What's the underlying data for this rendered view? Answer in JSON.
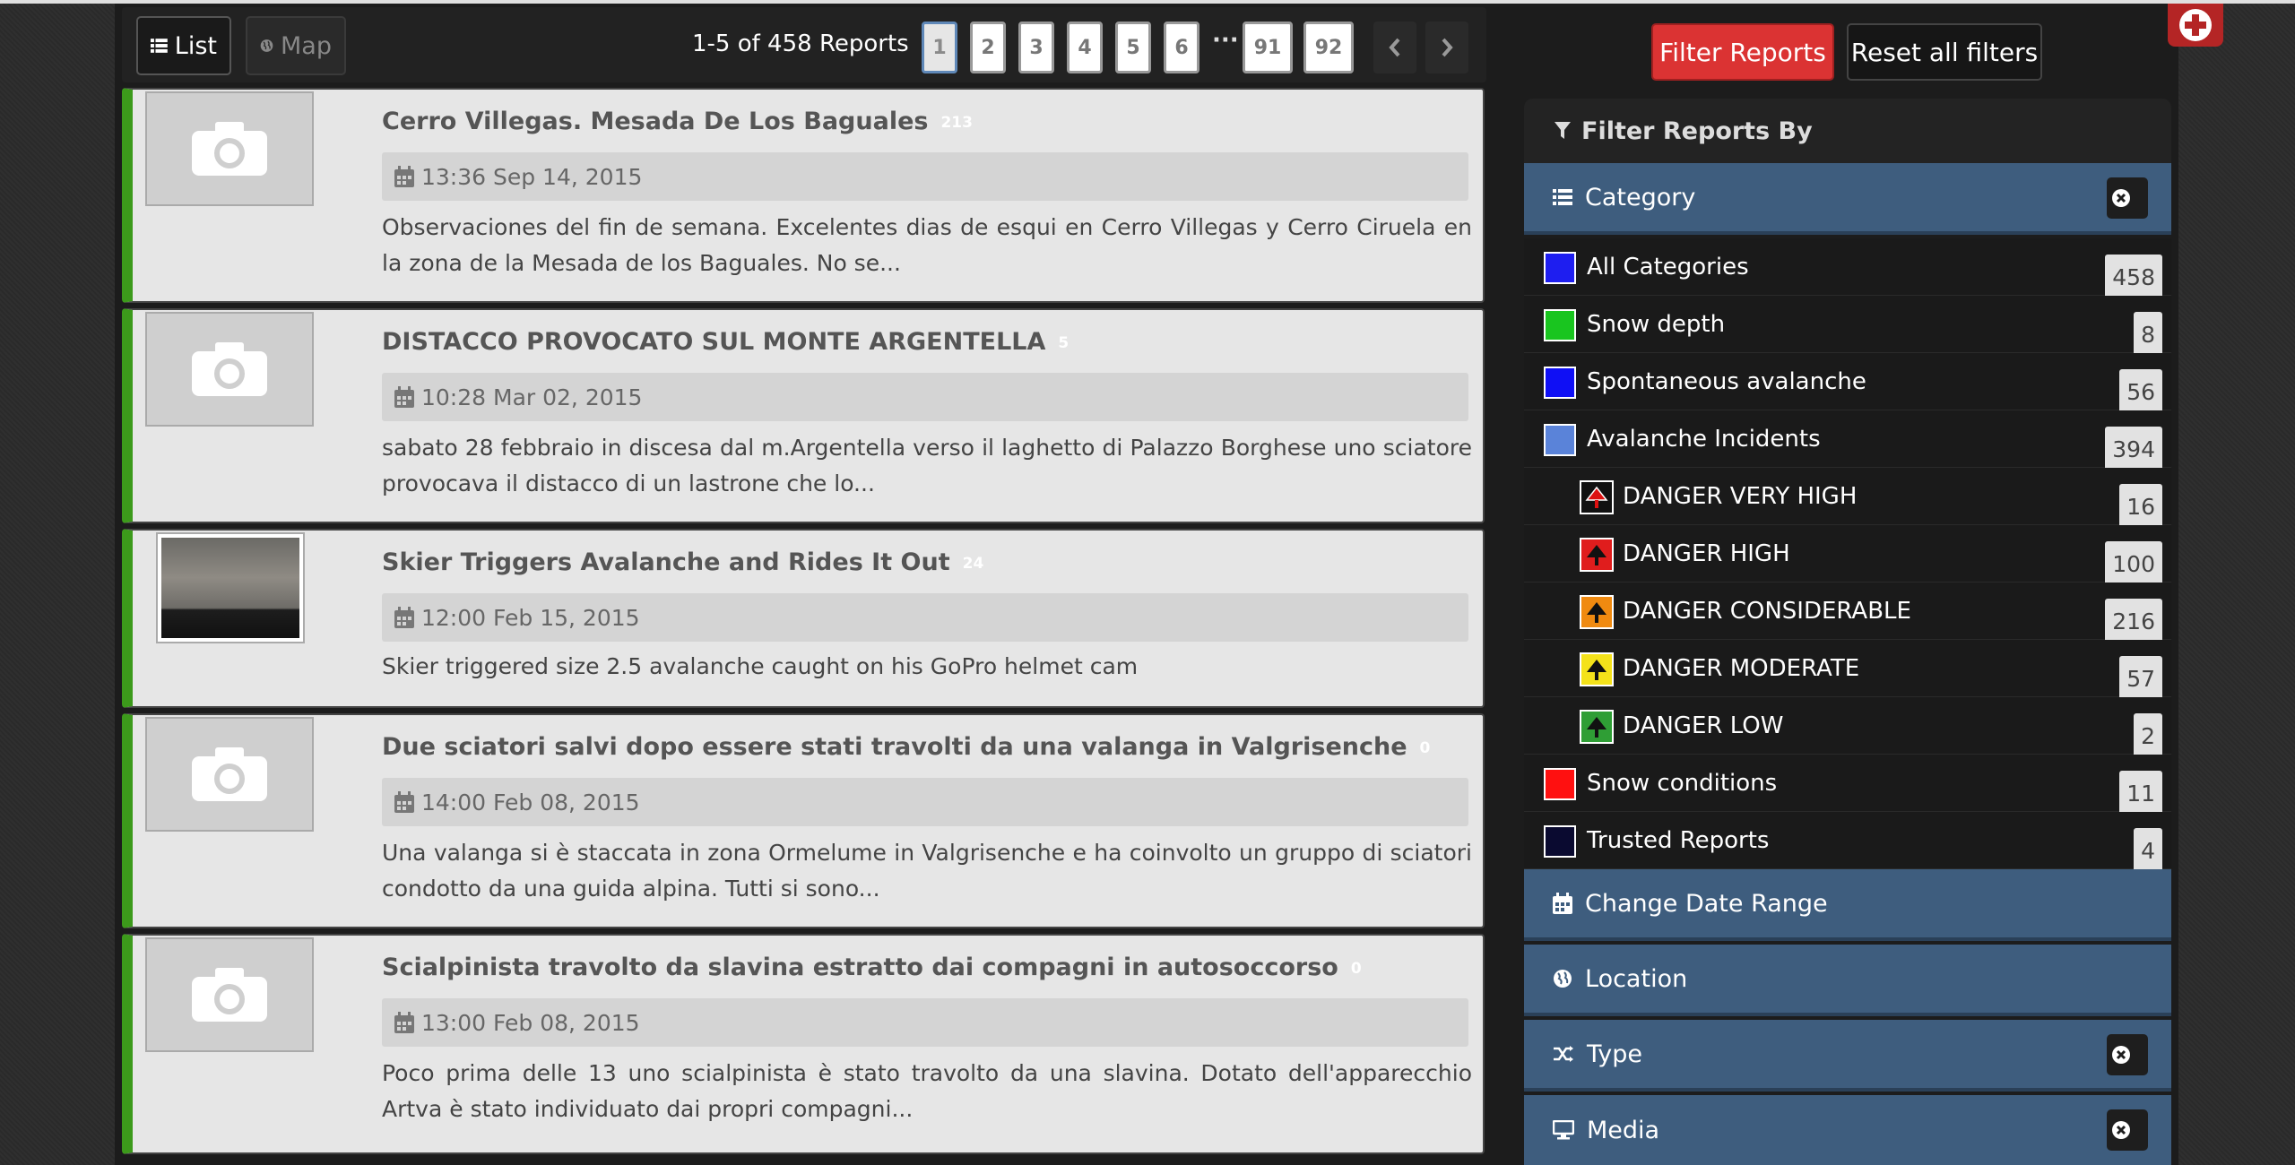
{
  "view_toggle": {
    "list_label": "List",
    "map_label": "Map"
  },
  "pagination": {
    "count_text": "1-5 of 458 Reports",
    "pages": [
      "1",
      "2",
      "3",
      "4",
      "5",
      "6",
      "91",
      "92"
    ],
    "ellipsis": "···",
    "active_page": "1"
  },
  "reports": [
    {
      "title": "Cerro Villegas. Mesada De Los Baguales",
      "comments": "213",
      "date": "13:36 Sep 14, 2015",
      "description": "Observaciones del fin de semana. Excelentes dias de esqui en Cerro Villegas y Cerro Ciruela en la zona de la Mesada de los Baguales. No se...",
      "thumb": "camera-icon"
    },
    {
      "title": "DISTACCO PROVOCATO SUL MONTE ARGENTELLA",
      "comments": "5",
      "date": "10:28 Mar 02, 2015",
      "description": "sabato 28 febbraio in discesa dal m.Argentella verso il laghetto di Palazzo Borghese uno sciatore provocava il distacco di un lastrone che lo...",
      "thumb": "camera-icon"
    },
    {
      "title": "Skier Triggers Avalanche and Rides It Out",
      "comments": "24",
      "date": "12:00 Feb 15, 2015",
      "description": "Skier triggered size 2.5 avalanche caught on his GoPro helmet cam",
      "thumb": "video-thumbnail"
    },
    {
      "title": "Due sciatori salvi dopo essere stati travolti da una valanga in Valgrisenche",
      "comments": "0",
      "date": "14:00 Feb 08, 2015",
      "description": "Una valanga si è staccata in zona Ormelume in Valgrisenche e ha coinvolto un gruppo di sciatori condotto da una guida alpina. Tutti si sono...",
      "thumb": "camera-icon"
    },
    {
      "title": "Scialpinista travolto da slavina estratto dai compagni in autosoccorso",
      "comments": "0",
      "date": "13:00 Feb 08, 2015",
      "description": "Poco prima delle 13 uno scialpinista è stato travolto da una slavina. Dotato dell'apparecchio Artva è stato individuato dai propri compagni...",
      "thumb": "camera-icon"
    }
  ],
  "actions": {
    "filter_label": "Filter Reports",
    "reset_label": "Reset all filters"
  },
  "filters": {
    "heading": "Filter Reports By",
    "category_label": "Category",
    "categories": [
      {
        "label": "All Categories",
        "count": "458",
        "color": "#1e1ef0"
      },
      {
        "label": "Snow depth",
        "count": "8",
        "color": "#19c51f"
      },
      {
        "label": "Spontaneous avalanche",
        "count": "56",
        "color": "#0f0ff5"
      },
      {
        "label": "Avalanche Incidents",
        "count": "394",
        "color": "#5a83d9"
      },
      {
        "label": "DANGER VERY HIGH",
        "count": "16",
        "color": "#111111",
        "icon": "danger-very-high-icon"
      },
      {
        "label": "DANGER HIGH",
        "count": "100",
        "color": "#e01d1d",
        "icon": "danger-high-icon"
      },
      {
        "label": "DANGER CONSIDERABLE",
        "count": "216",
        "color": "#f08a10",
        "icon": "danger-considerable-icon"
      },
      {
        "label": "DANGER MODERATE",
        "count": "57",
        "color": "#f4e21a",
        "icon": "danger-moderate-icon"
      },
      {
        "label": "DANGER LOW",
        "count": "2",
        "color": "#2f9e35",
        "icon": "danger-low-icon"
      },
      {
        "label": "Snow conditions",
        "count": "11",
        "color": "#ff1010"
      },
      {
        "label": "Trusted Reports",
        "count": "4",
        "color": "#0a0a30"
      }
    ],
    "sections": [
      "Change Date Range",
      "Location",
      "Type",
      "Media"
    ]
  },
  "colors": {
    "accent_green": "#3c9a1b",
    "section_blue": "#3e5d7e",
    "filter_red": "#db3333"
  }
}
